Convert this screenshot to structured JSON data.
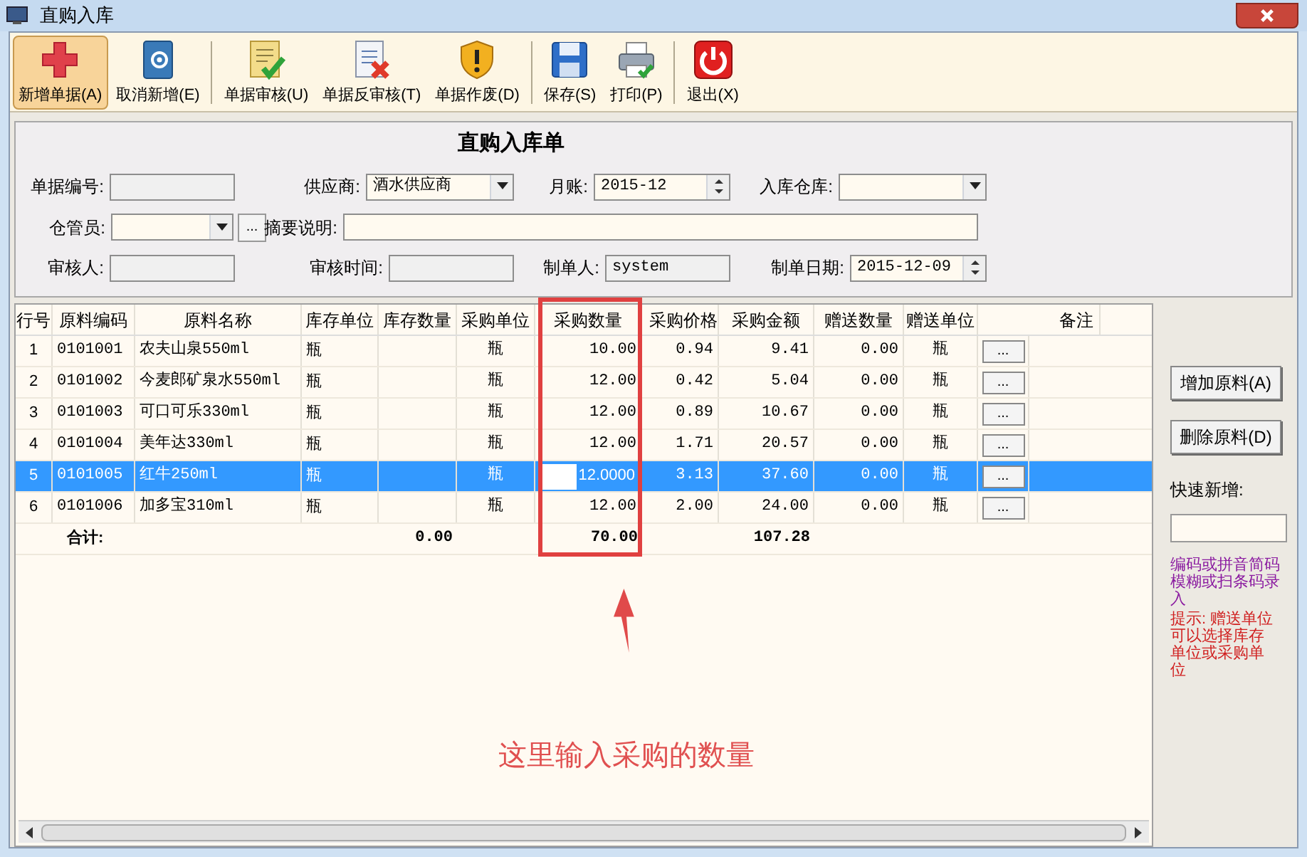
{
  "window": {
    "title": "直购入库"
  },
  "toolbar": {
    "buttons": [
      {
        "label": "新增单据(A)",
        "selected": true
      },
      {
        "label": "取消新增(E)",
        "selected": false
      },
      {
        "label": "单据审核(U)",
        "selected": false
      },
      {
        "label": "单据反审核(T)",
        "selected": false
      },
      {
        "label": "单据作废(D)",
        "selected": false
      },
      {
        "label": "保存(S)",
        "selected": false
      },
      {
        "label": "打印(P)",
        "selected": false
      },
      {
        "label": "退出(X)",
        "selected": false
      }
    ]
  },
  "form": {
    "title": "直购入库单",
    "rows": [
      [
        {
          "label": "单据编号:",
          "kind": "text",
          "disabled": true
        },
        {
          "label": "供应商:",
          "kind": "combo",
          "value": "酒水供应商",
          "disabled": false
        },
        {
          "label": "月账:",
          "kind": "spin",
          "value": "2015-12",
          "disabled": false
        },
        {
          "label": "入库仓库:",
          "kind": "combo",
          "disabled": false
        }
      ],
      [
        {
          "label": "仓管员:",
          "kind": "combo_more",
          "more": "...",
          "disabled": false
        },
        {
          "label": "摘要说明:",
          "kind": "memo",
          "disabled": false
        }
      ],
      [
        {
          "label": "审核人:",
          "kind": "text",
          "disabled": true
        },
        {
          "label": "审核时间:",
          "kind": "text",
          "disabled": true
        },
        {
          "label": "制单人:",
          "kind": "text",
          "value": "system",
          "disabled": true
        },
        {
          "label": "制单日期:",
          "kind": "spin",
          "value": "2015-12-09",
          "disabled": false
        }
      ]
    ]
  },
  "table": {
    "columns": [
      "行号",
      "原料编码",
      "原料名称",
      "库存单位",
      "库存数量",
      "采购单位",
      "采购数量",
      "采购价格",
      "采购金额",
      "赠送数量",
      "赠送单位",
      "备注"
    ],
    "rows": [
      {
        "selected": false,
        "cells": [
          "1",
          "0101001",
          "农夫山泉550ml",
          "瓶",
          "",
          "瓶",
          "10.00",
          "0.94",
          "9.41",
          "0.00",
          "瓶"
        ],
        "button": "..."
      },
      {
        "selected": false,
        "cells": [
          "2",
          "0101002",
          "今麦郎矿泉水550ml",
          "瓶",
          "",
          "瓶",
          "12.00",
          "0.42",
          "5.04",
          "0.00",
          "瓶"
        ],
        "button": "..."
      },
      {
        "selected": false,
        "cells": [
          "3",
          "0101003",
          "可口可乐330ml",
          "瓶",
          "",
          "瓶",
          "12.00",
          "0.89",
          "10.67",
          "0.00",
          "瓶"
        ],
        "button": "..."
      },
      {
        "selected": false,
        "cells": [
          "4",
          "0101004",
          "美年达330ml",
          "瓶",
          "",
          "瓶",
          "12.00",
          "1.71",
          "20.57",
          "0.00",
          "瓶"
        ],
        "button": "..."
      },
      {
        "selected": true,
        "cells": [
          "5",
          "0101005",
          "红牛250ml",
          "瓶",
          "",
          "瓶",
          "12.0000",
          "3.13",
          "37.60",
          "0.00",
          "瓶"
        ],
        "button": "..."
      },
      {
        "selected": false,
        "cells": [
          "6",
          "0101006",
          "加多宝310ml",
          "瓶",
          "",
          "瓶",
          "12.00",
          "2.00",
          "24.00",
          "0.00",
          "瓶"
        ],
        "button": "..."
      }
    ],
    "totals": {
      "label": "合计:",
      "stock_qty": "0.00",
      "purchase_qty": "70.00",
      "amount": "107.28"
    }
  },
  "side_panel": {
    "buttons": [
      "增加原料(A)",
      "删除原料(D)"
    ],
    "quick_add_label": "快速新增:",
    "quick_add_hint": "编码或拼音简码模糊或扫条码录入",
    "tip": "提示: 赠送单位可以选择库存单位或采购单位"
  },
  "annotation": {
    "text": "这里输入采购的数量"
  }
}
